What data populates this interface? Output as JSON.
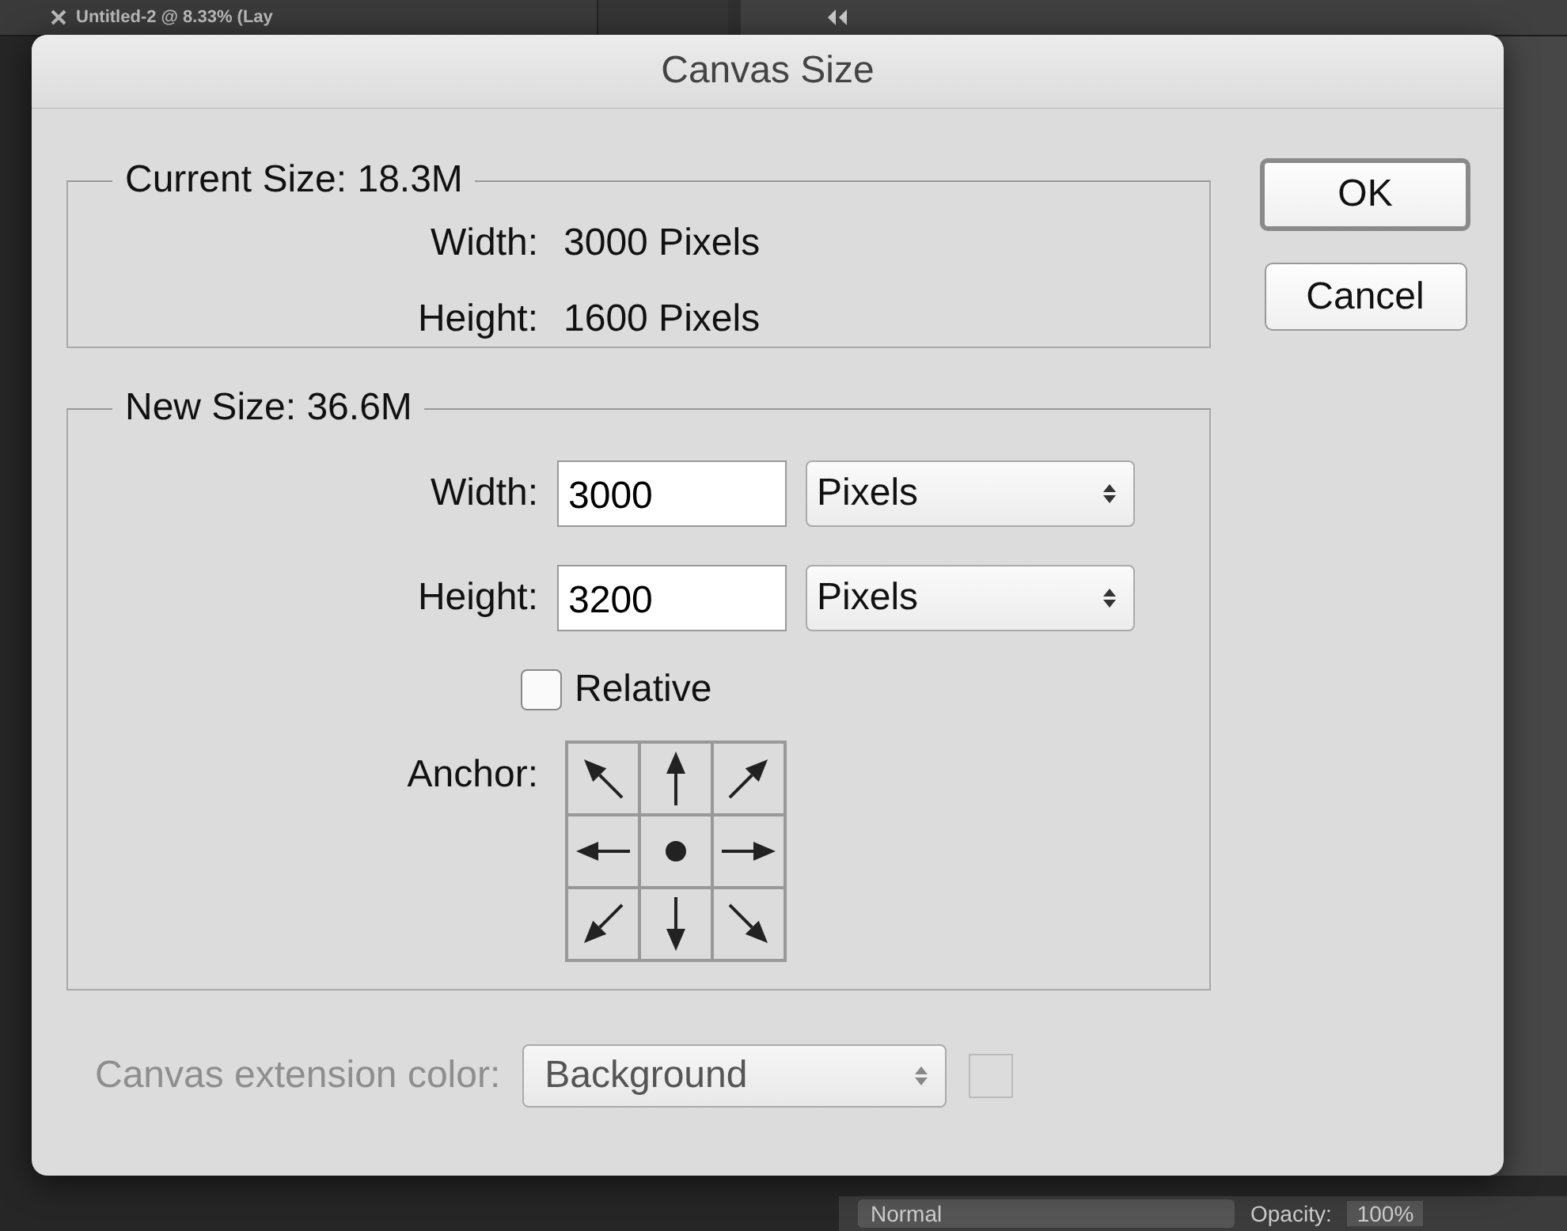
{
  "background": {
    "document_tab": "Untitled-2 @ 8.33% (Lay",
    "blend_mode": "Normal",
    "opacity_label": "Opacity:",
    "opacity_value": "100%"
  },
  "dialog": {
    "title": "Canvas Size",
    "current_size": {
      "legend": "Current Size: 18.3M",
      "rows": [
        {
          "label": "Width:",
          "value": "3000 Pixels"
        },
        {
          "label": "Height:",
          "value": "1600 Pixels"
        }
      ]
    },
    "new_size": {
      "legend": "New Size: 36.6M",
      "fields": [
        {
          "label": "Width:",
          "value": "3000",
          "unit": "Pixels"
        },
        {
          "label": "Height:",
          "value": "3200",
          "unit": "Pixels"
        }
      ],
      "relative": {
        "label": "Relative",
        "checked": false
      },
      "anchor": {
        "label": "Anchor:",
        "cells": [
          {
            "selected": false
          },
          {
            "selected": false
          },
          {
            "selected": false
          },
          {
            "selected": false
          },
          {
            "selected": true
          },
          {
            "selected": false
          },
          {
            "selected": false
          },
          {
            "selected": false
          },
          {
            "selected": false
          }
        ]
      }
    },
    "extension_color": {
      "label": "Canvas extension color:",
      "value": "Background",
      "disabled": true
    },
    "buttons": [
      {
        "label": "OK",
        "default": true
      },
      {
        "label": "Cancel",
        "default": false
      }
    ]
  }
}
